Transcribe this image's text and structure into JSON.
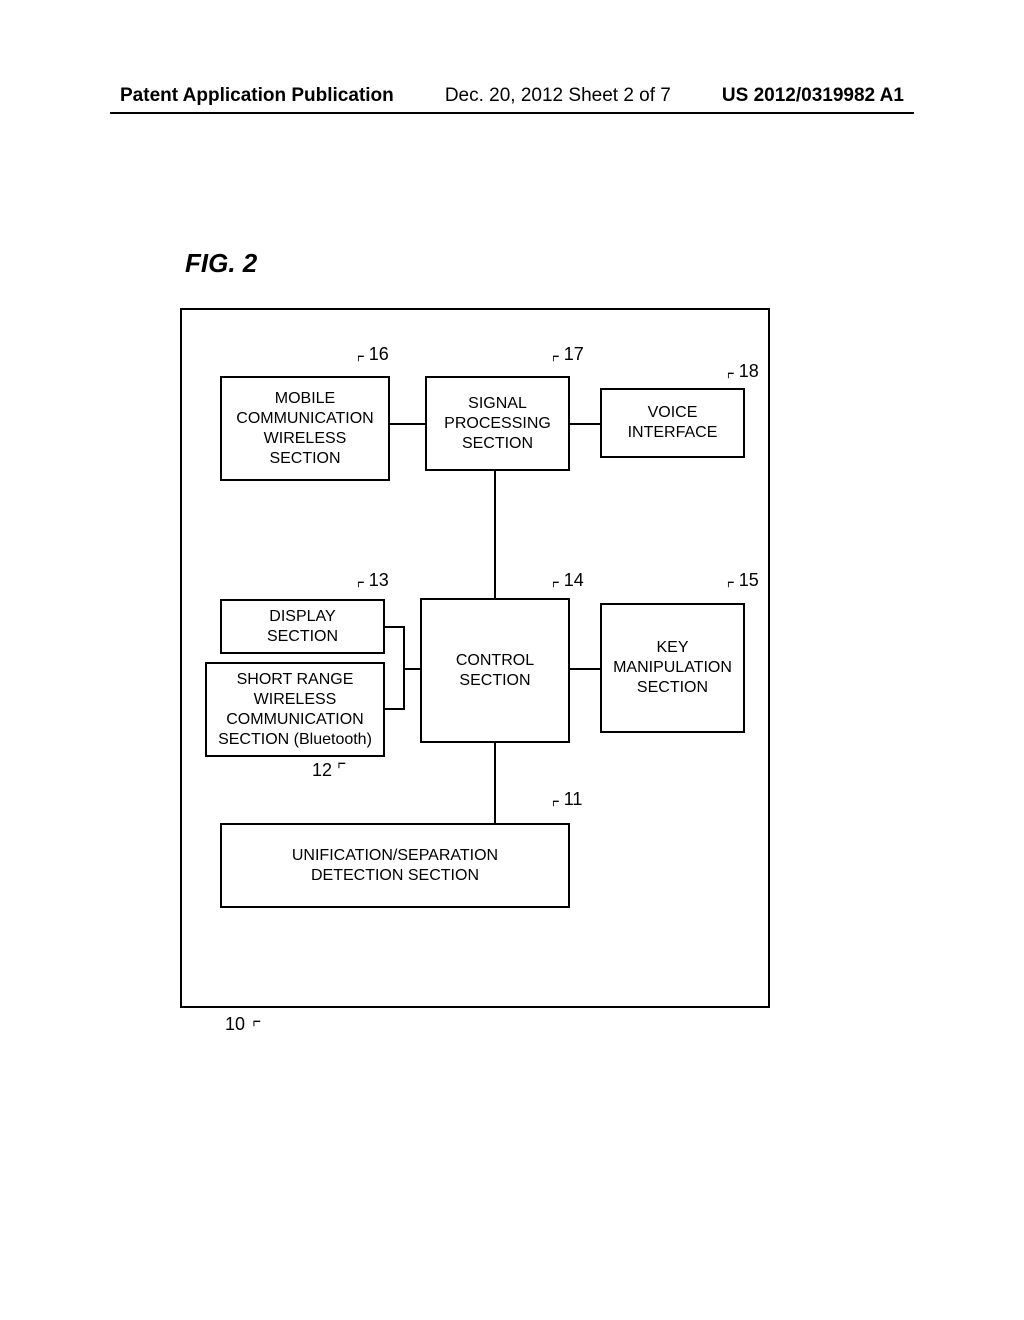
{
  "header": {
    "left": "Patent Application Publication",
    "center": "Dec. 20, 2012  Sheet 2 of 7",
    "right": "US 2012/0319982 A1"
  },
  "figure": {
    "label": "FIG. 2",
    "outer_ref": "10",
    "blocks": {
      "unisep": {
        "ref": "11",
        "text": "UNIFICATION/SEPARATION\nDETECTION SECTION"
      },
      "shortrng": {
        "ref": "12",
        "text": "SHORT RANGE\nWIRELESS\nCOMMUNICATION\nSECTION (Bluetooth)"
      },
      "display": {
        "ref": "13",
        "text": "DISPLAY\nSECTION"
      },
      "control": {
        "ref": "14",
        "text": "CONTROL\nSECTION"
      },
      "keyman": {
        "ref": "15",
        "text": "KEY\nMANIPULATION\nSECTION"
      },
      "mobcom": {
        "ref": "16",
        "text": "MOBILE\nCOMMUNICATION\nWIRELESS\nSECTION"
      },
      "sigproc": {
        "ref": "17",
        "text": "SIGNAL\nPROCESSING\nSECTION"
      },
      "voice": {
        "ref": "18",
        "text": "VOICE\nINTERFACE"
      }
    }
  }
}
